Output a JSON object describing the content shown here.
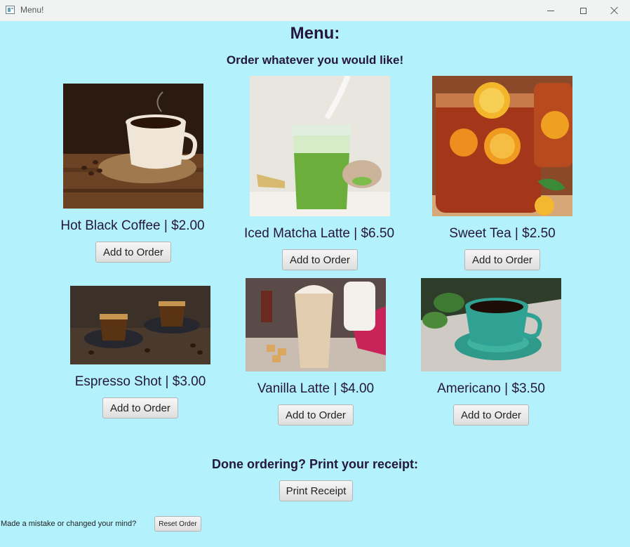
{
  "window": {
    "title": "Menu!",
    "icons": {
      "app": "app-window-icon",
      "minimize": "minimize-icon",
      "maximize": "maximize-icon",
      "close": "close-icon"
    }
  },
  "header": {
    "title": "Menu:",
    "subtitle": "Order whatever you would like!"
  },
  "items": [
    {
      "label": "Hot Black Coffee | $2.00",
      "button": "Add to Order",
      "image": "hot-black-coffee-photo"
    },
    {
      "label": "Iced Matcha Latte | $6.50",
      "button": "Add to Order",
      "image": "iced-matcha-latte-photo"
    },
    {
      "label": "Sweet Tea | $2.50",
      "button": "Add to Order",
      "image": "sweet-tea-photo"
    },
    {
      "label": "Espresso Shot | $3.00",
      "button": "Add to Order",
      "image": "espresso-shot-photo"
    },
    {
      "label": "Vanilla Latte | $4.00",
      "button": "Add to Order",
      "image": "vanilla-latte-photo"
    },
    {
      "label": "Americano | $3.50",
      "button": "Add to Order",
      "image": "americano-photo"
    }
  ],
  "receipt": {
    "prompt": "Done ordering? Print your receipt:",
    "button": "Print Receipt"
  },
  "reset": {
    "prompt": "Made a mistake or changed your mind?",
    "button": "Reset Order"
  },
  "colors": {
    "background": "#b3f2fc",
    "text": "#24163f",
    "titlebar": "#f1f3f3"
  }
}
